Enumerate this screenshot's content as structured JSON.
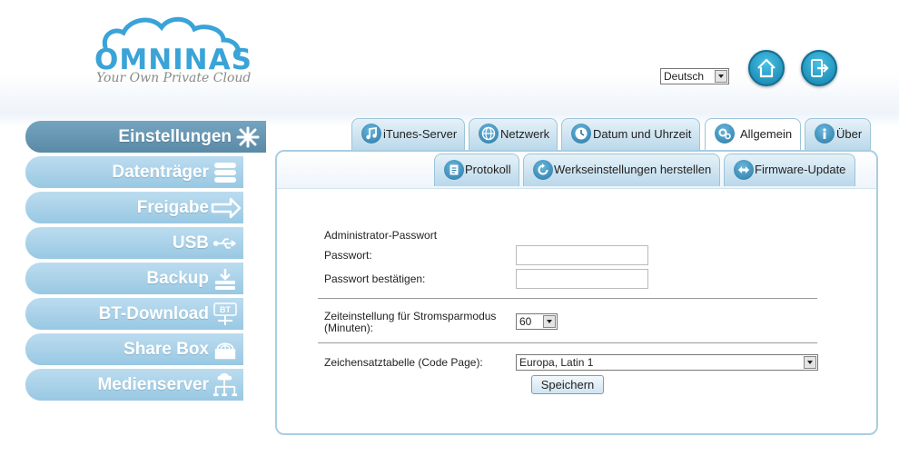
{
  "brand": {
    "name": "OMNINAS",
    "tagline": "Your Own Private Cloud"
  },
  "header": {
    "language": "Deutsch",
    "home_icon": "home-icon",
    "logout_icon": "logout-icon"
  },
  "sidebar": {
    "items": [
      {
        "label": "Einstellungen",
        "icon": "settings-icon",
        "active": true
      },
      {
        "label": "Datenträger",
        "icon": "disks-icon"
      },
      {
        "label": "Freigabe",
        "icon": "share-icon"
      },
      {
        "label": "USB",
        "icon": "usb-icon"
      },
      {
        "label": "Backup",
        "icon": "backup-icon"
      },
      {
        "label": "BT-Download",
        "icon": "bt-download-icon",
        "icon_text": "BT"
      },
      {
        "label": "Share Box",
        "icon": "share-box-icon"
      },
      {
        "label": "Medienserver",
        "icon": "media-server-icon"
      }
    ]
  },
  "tabs": [
    {
      "label": "iTunes-Server",
      "icon": "music-note-icon"
    },
    {
      "label": "Netzwerk",
      "icon": "globe-icon"
    },
    {
      "label": "Datum und Uhrzeit",
      "icon": "clock-icon"
    },
    {
      "label": "Allgemein",
      "icon": "gears-icon",
      "active": true
    },
    {
      "label": "Über",
      "icon": "info-icon"
    }
  ],
  "subtabs": [
    {
      "label": "Protokoll",
      "icon": "log-icon"
    },
    {
      "label": "Werkseinstellungen herstellen",
      "icon": "reset-icon"
    },
    {
      "label": "Firmware-Update",
      "icon": "update-icon"
    }
  ],
  "form": {
    "section_title": "Administrator-Passwort",
    "password_label": "Passwort:",
    "password_value": "",
    "confirm_label": "Passwort bestätigen:",
    "confirm_value": "",
    "sleep_label_line1": "Zeiteinstellung für Stromsparmodus",
    "sleep_label_line2": "(Minuten):",
    "sleep_value": "60",
    "codepage_label": "Zeichensatztabelle (Code Page):",
    "codepage_value": "Europa, Latin 1",
    "save_label": "Speichern"
  },
  "colors": {
    "accent": "#3aa3d8",
    "sidebar_active": "#6a9ab5",
    "sidebar": "#aed3ea",
    "tab_border": "#9cc4da"
  }
}
